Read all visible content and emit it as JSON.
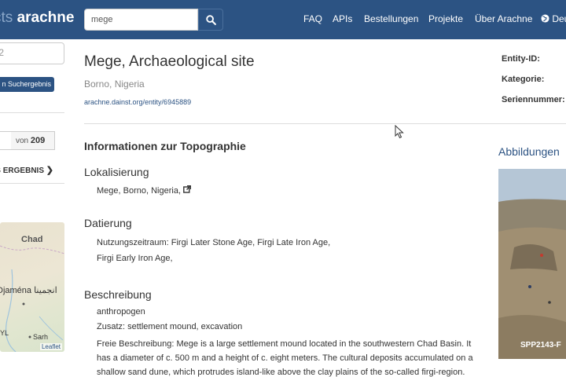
{
  "navbar": {
    "brand_prefix": "cts ",
    "brand_name": "arachne",
    "search_value": "mege",
    "links": [
      "FAQ",
      "APIs",
      "Bestellungen",
      "Projekte",
      "Über Arachne",
      "Deu"
    ]
  },
  "sidebar": {
    "search_placeholder": "2",
    "back_label": "n Suchergebnis",
    "pager_of": "von",
    "pager_total": "209",
    "next_label": "ES ERGEBNIS",
    "map": {
      "country_label": "Chad",
      "city_label": "Djaména انجمينا",
      "small_label_1": "YL",
      "small_label_2": "Sarh",
      "leaflet": "Leaflet"
    }
  },
  "entity": {
    "title": "Mege, Archaeological site",
    "subtitle": "Borno, Nigeria",
    "link": "arachne.dainst.org/entity/6945889"
  },
  "meta": {
    "entity_id_label": "Entity-ID:",
    "kategorie_label": "Kategorie:",
    "seriennummer_label": "Seriennummer:"
  },
  "topography": {
    "section_title": "Informationen zur Topographie",
    "lokalisierung_heading": "Lokalisierung",
    "lokalisierung_value": "Mege, Borno, Nigeria,",
    "datierung_heading": "Datierung",
    "datierung_line1": "Nutzungszeitraum: Firgi Later Stone Age, Firgi Late Iron Age,",
    "datierung_line2": "Firgi Early Iron Age,",
    "beschreibung_heading": "Beschreibung",
    "beschreibung_line1": "anthropogen",
    "beschreibung_line2": "Zusatz: settlement mound, excavation",
    "beschreibung_para": "Freie Beschreibung: Mege is a large settlement mound located in the southwestern Chad Basin. It has a diameter of c. 500 m and a height of c. eight meters. The cultural deposits accumulated on a shallow sand dune, which protrudes island-like above the clay plains of the so-called firgi-region."
  },
  "images": {
    "heading": "Abbildungen",
    "caption": "SPP2143-F"
  }
}
